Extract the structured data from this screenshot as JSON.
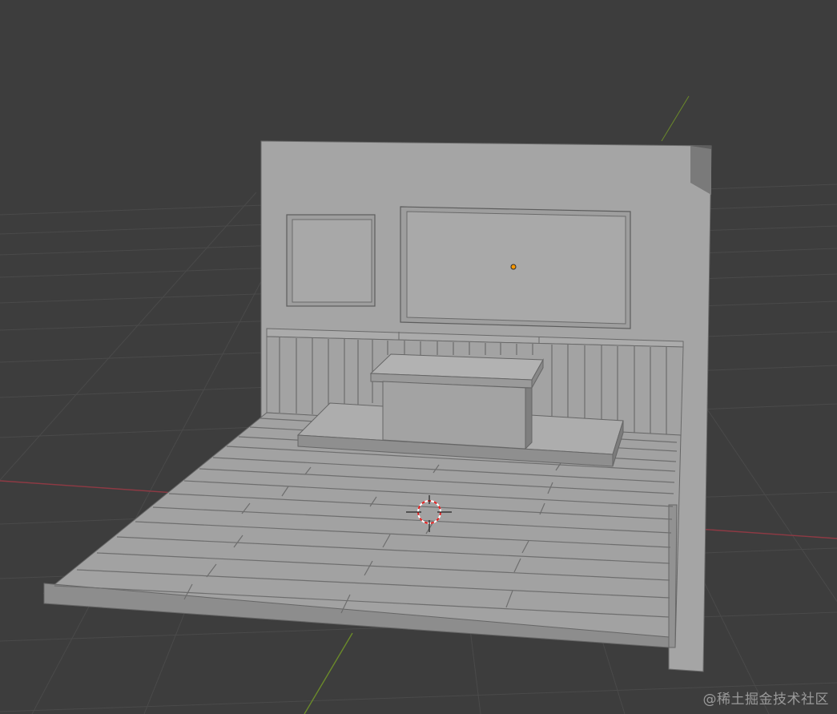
{
  "viewport": {
    "background": "#3d3d3d",
    "grid_color": "#4a4a4a",
    "x_axis_color": "#8e3a44",
    "y_axis_color": "#6b8a2a"
  },
  "scene": {
    "material_color": "#a3a3a3",
    "origin_dot_color": "#ff9900",
    "cursor_colors": [
      "#e02020",
      "#ffffff"
    ]
  },
  "watermark": {
    "text": "@稀土掘金技术社区"
  }
}
